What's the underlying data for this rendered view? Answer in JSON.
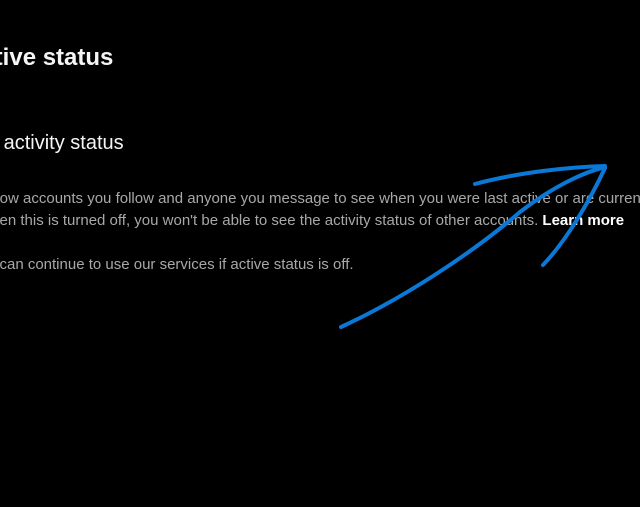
{
  "header": {
    "title": "Active status"
  },
  "section": {
    "title": "Show activity status",
    "description_line1": "Allow accounts you follow and anyone you message to see when you were last active or are currently active on Instagram.",
    "description_line2_prefix": "When this is turned off, you won't be able to see the activity status of other accounts. ",
    "learn_more": "Learn more",
    "description_line3": "You can continue to use our services if active status is off."
  },
  "annotation": {
    "icon": "arrow-annotation",
    "color": "#0a78d7"
  }
}
